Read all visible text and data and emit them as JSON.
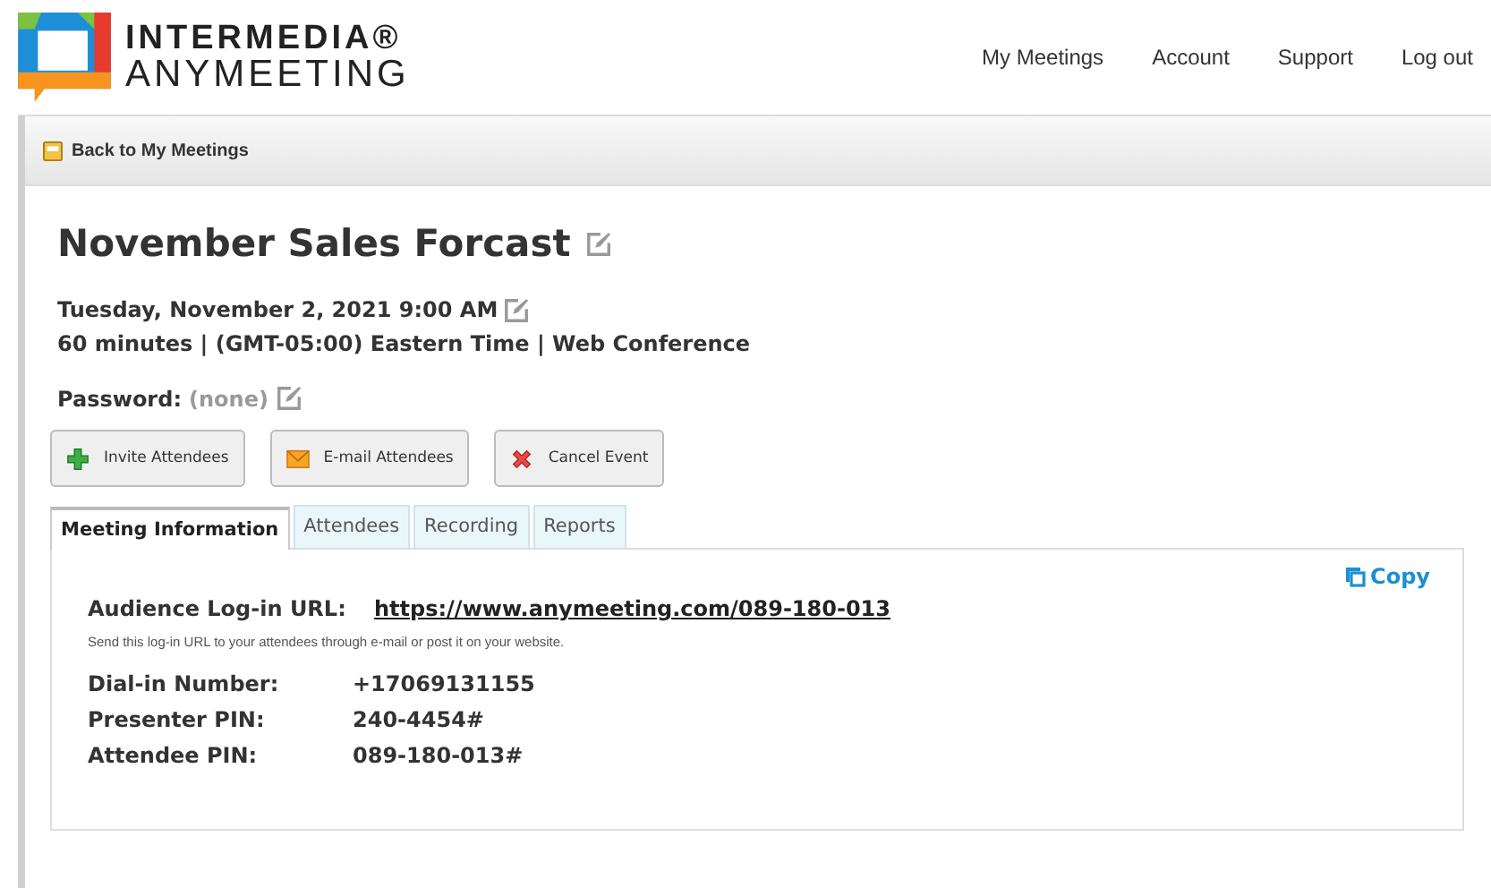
{
  "brand": {
    "line_1": "INTERMEDIA®",
    "line_2": "ANYMEETING"
  },
  "nav": [
    "My Meetings",
    "Account",
    "Support",
    "Log out"
  ],
  "toolbar": {
    "back_link": "Back to My Meetings"
  },
  "meeting": {
    "title": "November Sales Forcast",
    "date": "Tuesday, November 2, 2021 9:00 AM",
    "details": "60 minutes | (GMT-05:00) Eastern Time | Web Conference",
    "password_label": "Password:",
    "password_value": "(none)"
  },
  "actions": [
    {
      "label": "Invite Attendees",
      "kind": "add"
    },
    {
      "label": "E-mail Attendees",
      "kind": "email"
    },
    {
      "label": "Cancel Event",
      "kind": "cancel"
    }
  ],
  "tabs": [
    {
      "label": "Meeting Information",
      "selected": true
    },
    {
      "label": "Attendees",
      "selected": false
    },
    {
      "label": "Recording",
      "selected": false
    },
    {
      "label": "Reports",
      "selected": false
    }
  ],
  "info": {
    "copy": "Copy",
    "url_label": "Audience Log-in URL:",
    "url": "https://www.anymeeting.com/089-180-013",
    "hint": "Send this log-in URL to your attendees through e-mail or post it on your website.",
    "rows": [
      {
        "label": "Dial-in Number:",
        "value": "+17069131155"
      },
      {
        "label": "Presenter PIN:",
        "value": "240-4454#"
      },
      {
        "label": "Attendee PIN:",
        "value": "089-180-013#"
      }
    ]
  }
}
